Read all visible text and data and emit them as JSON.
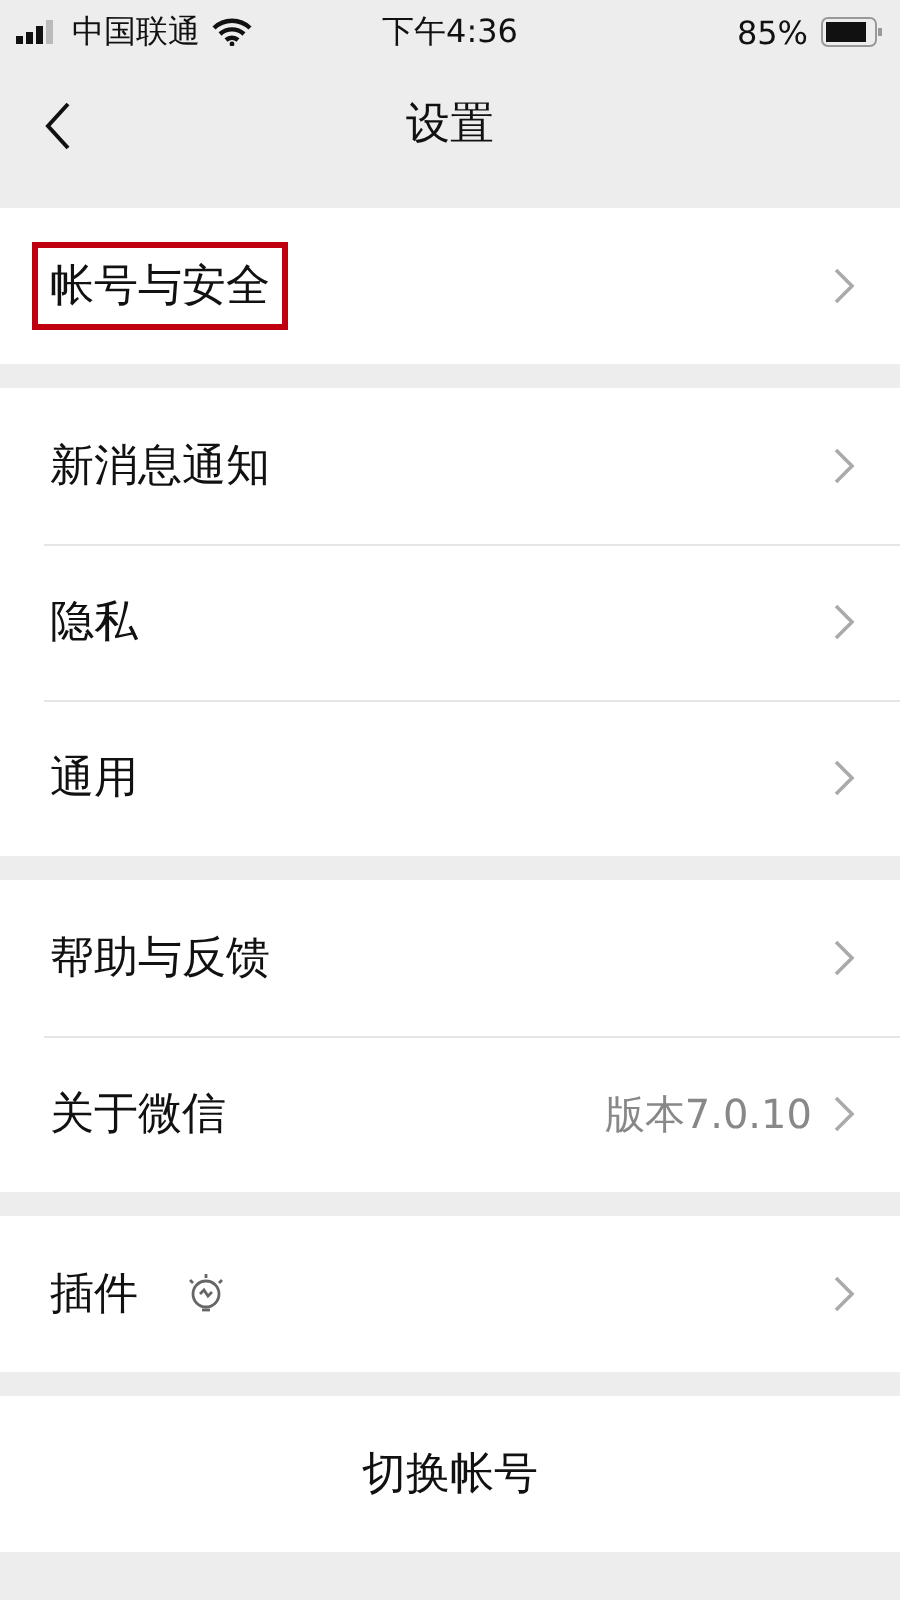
{
  "status_bar": {
    "carrier": "中国联通",
    "time": "下午4:36",
    "battery": "85%"
  },
  "nav": {
    "title": "设置"
  },
  "groups": [
    {
      "items": [
        {
          "label": "帐号与安全",
          "highlighted": true
        }
      ]
    },
    {
      "items": [
        {
          "label": "新消息通知",
          "highlighted": false
        },
        {
          "label": "隐私",
          "highlighted": false
        },
        {
          "label": "通用",
          "highlighted": false
        }
      ]
    },
    {
      "items": [
        {
          "label": "帮助与反馈",
          "highlighted": false
        },
        {
          "label": "关于微信",
          "value": "版本7.0.10",
          "highlighted": false
        }
      ]
    },
    {
      "items": [
        {
          "label": "插件",
          "kind": "with_icon",
          "highlighted": false
        }
      ]
    }
  ],
  "action": {
    "label": "切换帐号"
  }
}
